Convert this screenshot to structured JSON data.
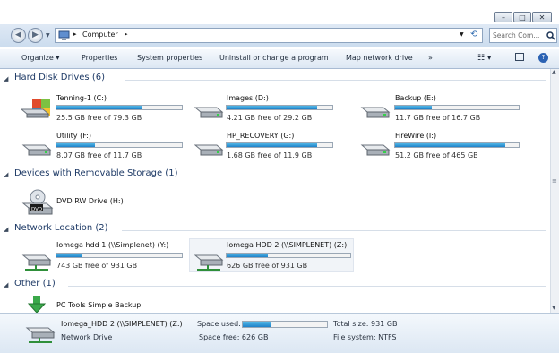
{
  "window": {
    "caption_buttons": {
      "minimize": "–",
      "maximize": "□",
      "close": "✕"
    }
  },
  "address": {
    "path_icon": "computer-icon",
    "crumb": "Computer",
    "search_placeholder": "Search Com..."
  },
  "toolbar": {
    "organize": "Organize ▾",
    "properties": "Properties",
    "system_properties": "System properties",
    "uninstall": "Uninstall or change a program",
    "map_network_drive": "Map network drive",
    "more": "»"
  },
  "groups": {
    "hard_disk": "Hard Disk Drives (6)",
    "removable": "Devices with Removable Storage (1)",
    "network": "Network Location (2)",
    "other": "Other (1)"
  },
  "hard_disks": [
    {
      "label": "Tenning-1 (C:)",
      "free": "25.5 GB free of 79.3 GB",
      "used_fraction": 0.68
    },
    {
      "label": "Images (D:)",
      "free": "4.21 GB free of 29.2 GB",
      "used_fraction": 0.86
    },
    {
      "label": "Backup (E:)",
      "free": "11.7 GB free of 16.7 GB",
      "used_fraction": 0.3
    },
    {
      "label": "Utility (F:)",
      "free": "8.07 GB free of 11.7 GB",
      "used_fraction": 0.31
    },
    {
      "label": "HP_RECOVERY (G:)",
      "free": "1.68 GB free of 11.9 GB",
      "used_fraction": 0.86
    },
    {
      "label": "FireWire (I:)",
      "free": "51.2 GB free of 465 GB",
      "used_fraction": 0.89
    }
  ],
  "removable": [
    {
      "label": "DVD RW Drive (H:)",
      "badge": "DVD"
    }
  ],
  "network": [
    {
      "label": "Iomega hdd 1 (\\\\Simplenet) (Y:)",
      "free": "743 GB free of 931 GB",
      "used_fraction": 0.2
    },
    {
      "label": "Iomega HDD 2 (\\\\SIMPLENET) (Z:)",
      "free": "626 GB free of 931 GB",
      "used_fraction": 0.33
    }
  ],
  "other": [
    {
      "label": "PC Tools Simple Backup"
    }
  ],
  "details": {
    "name": "Iomega_HDD 2 (\\\\SIMPLENET) (Z:)",
    "type": "Network Drive",
    "space_used_label": "Space used:",
    "space_used_fraction": 0.33,
    "space_free": "Space free: 626 GB",
    "total_size": "Total size: 931 GB",
    "filesystem": "File system: NTFS"
  },
  "colors": {
    "bar_fill": "#1f82c9",
    "group_heading": "#1e3a66"
  }
}
